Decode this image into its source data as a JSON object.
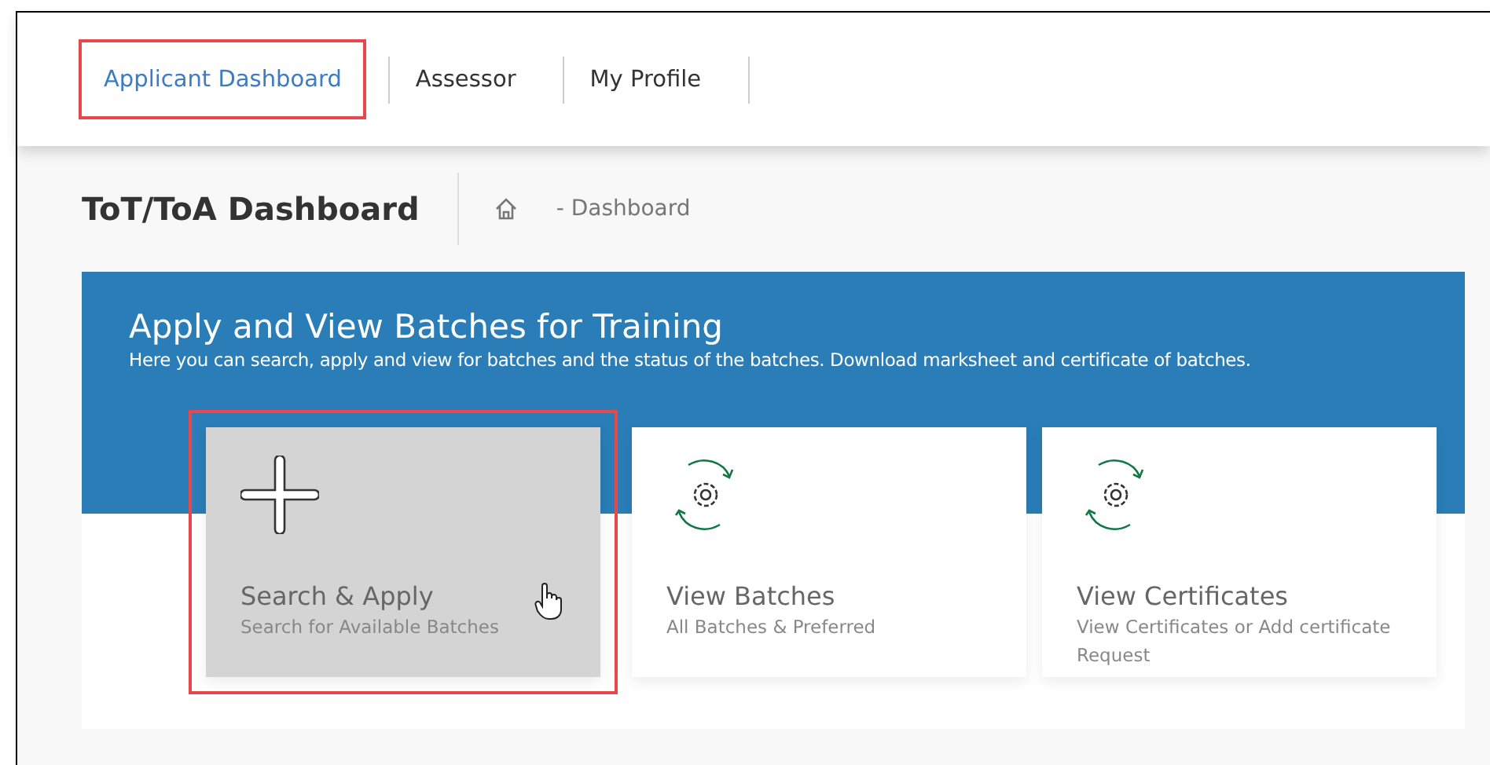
{
  "nav": {
    "items": [
      {
        "label": "Applicant Dashboard",
        "selected": true,
        "highlighted": true
      },
      {
        "label": "Assessor",
        "selected": false,
        "highlighted": false
      },
      {
        "label": "My Profile",
        "selected": false,
        "highlighted": false
      }
    ]
  },
  "page_title": "ToT/ToA Dashboard",
  "breadcrumb": {
    "current": "- Dashboard"
  },
  "banner": {
    "title": "Apply and View Batches for Training",
    "subtitle": "Here you can search, apply and view for batches and the status of the batches. Download marksheet and certificate of batches."
  },
  "cards": [
    {
      "kind": "plus",
      "title": "Search & Apply",
      "subtitle": "Search for Available Batches",
      "hovered": true,
      "highlighted": true
    },
    {
      "kind": "cycle",
      "title": "View Batches",
      "subtitle": "All Batches & Preferred",
      "hovered": false,
      "highlighted": false
    },
    {
      "kind": "cycle",
      "title": "View Certificates",
      "subtitle": "View Certificates or Add certificate Request",
      "hovered": false,
      "highlighted": false
    }
  ]
}
